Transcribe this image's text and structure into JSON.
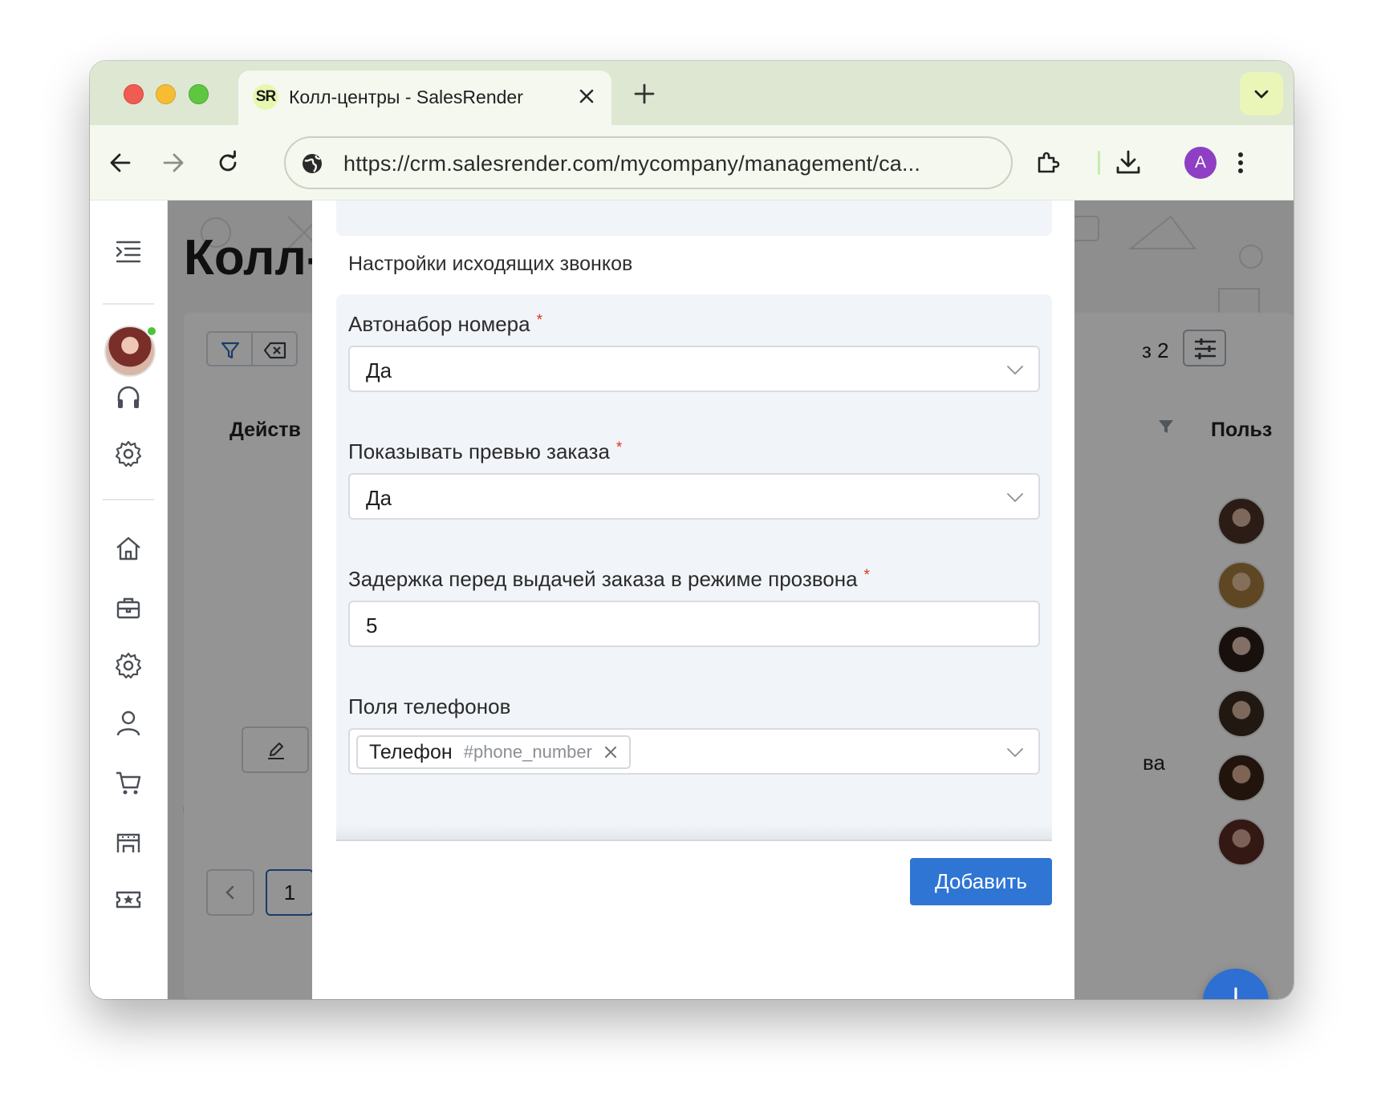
{
  "browser": {
    "tab_title": "Колл-центры - SalesRender",
    "tab_favicon_text": "SR",
    "url": "https://crm.salesrender.com/mycompany/management/ca...",
    "profile_initial": "A",
    "colors": {
      "tabbar": "#dde7d2",
      "toolbar": "#f4f8ef",
      "profile": "#8e3fc3"
    }
  },
  "sidebar": {
    "items": [
      {
        "icon": "menu-toggle-icon"
      },
      {
        "icon": "headset-icon"
      },
      {
        "icon": "gear-icon"
      },
      {
        "icon": "home-icon"
      },
      {
        "icon": "briefcase-icon"
      },
      {
        "icon": "settings-icon"
      },
      {
        "icon": "user-icon"
      },
      {
        "icon": "cart-icon"
      },
      {
        "icon": "building-icon"
      },
      {
        "icon": "ticket-star-icon"
      }
    ]
  },
  "page": {
    "title": "Колл-",
    "table_header_actions": "Действ",
    "table_header_users": "Польз",
    "pager_text": "з 2",
    "row_text": "ва",
    "current_page": "1"
  },
  "modal": {
    "section_title": "Настройки исходящих звонков",
    "required_mark": "*",
    "fields": {
      "autodial": {
        "label": "Автонабор номера",
        "value": "Да"
      },
      "order_preview": {
        "label": "Показывать превью заказа",
        "value": "Да"
      },
      "delay": {
        "label": "Задержка перед выдачей заказа в режиме прозвона",
        "value": "5"
      },
      "phone_fields": {
        "label": "Поля телефонов",
        "chip_label": "Телефон",
        "chip_code": "#phone_number"
      }
    },
    "submit_label": "Добавить",
    "colors": {
      "primary": "#2f75d4",
      "required": "#e0331f",
      "field_bg": "#f1f4f8"
    }
  }
}
